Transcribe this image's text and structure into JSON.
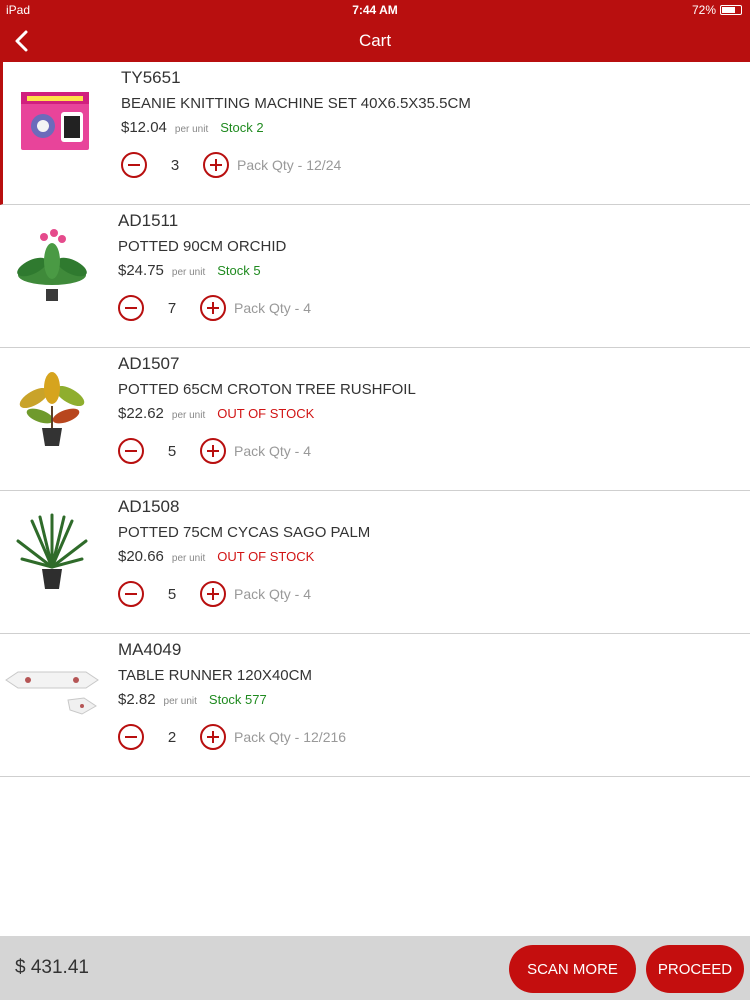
{
  "status_bar": {
    "device": "iPad",
    "time": "7:44 AM",
    "battery": "72%",
    "battery_level": 0.72
  },
  "header": {
    "title": "Cart",
    "back_icon": "chevron-left-icon"
  },
  "items": [
    {
      "sku": "TY5651",
      "name": "BEANIE KNITTING MACHINE SET 40X6.5X35.5CM",
      "price": "$12.04",
      "per_unit": "per unit",
      "stock": "Stock 2",
      "stock_status": "in",
      "qty": "3",
      "pack": "Pack Qty - 12/24"
    },
    {
      "sku": "AD1511",
      "name": "POTTED 90CM ORCHID",
      "price": "$24.75",
      "per_unit": "per unit",
      "stock": "Stock 5",
      "stock_status": "in",
      "qty": "7",
      "pack": "Pack Qty - 4"
    },
    {
      "sku": "AD1507",
      "name": "POTTED 65CM CROTON TREE RUSHFOIL",
      "price": "$22.62",
      "per_unit": "per unit",
      "stock": "OUT OF STOCK",
      "stock_status": "out",
      "qty": "5",
      "pack": "Pack Qty - 4"
    },
    {
      "sku": "AD1508",
      "name": "POTTED 75CM CYCAS SAGO PALM",
      "price": "$20.66",
      "per_unit": "per unit",
      "stock": "OUT OF STOCK",
      "stock_status": "out",
      "qty": "5",
      "pack": "Pack Qty - 4"
    },
    {
      "sku": "MA4049",
      "name": "TABLE RUNNER 120X40CM",
      "price": "$2.82",
      "per_unit": "per unit",
      "stock": "Stock 577",
      "stock_status": "in",
      "qty": "2",
      "pack": "Pack Qty - 12/216"
    }
  ],
  "footer": {
    "total": "$ 431.41",
    "scan_more": "SCAN MORE",
    "proceed": "PROCEED"
  },
  "colors": {
    "brand_red": "#b80f0f",
    "in_stock_green": "#1f8a1f",
    "out_of_stock_red": "#d11414",
    "footer_gray": "#d5d5d5"
  }
}
